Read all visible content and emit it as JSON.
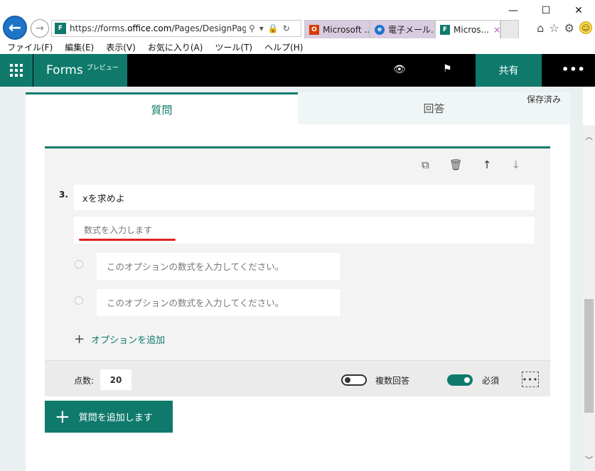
{
  "browser": {
    "url_prefix": "https://forms.",
    "url_domain": "office.com",
    "url_path": "/Pages/DesignPage.aspx",
    "tabs": [
      {
        "label": "Microsoft ..."
      },
      {
        "label": "電子メール..."
      },
      {
        "label": "Micros..."
      }
    ],
    "tab_close": "×"
  },
  "menu": {
    "items": [
      "ファイル(F)",
      "編集(E)",
      "表示(V)",
      "お気に入り(A)",
      "ツール(T)",
      "ヘルプ(H)"
    ]
  },
  "appbar": {
    "brand": "Forms",
    "preview_tag": "プレビュー",
    "share_label": "共有",
    "more_label": "•••"
  },
  "tabs": {
    "questions": "質問",
    "responses": "回答"
  },
  "status": {
    "saved": "保存済み"
  },
  "question": {
    "number": "3.",
    "title": "xを求めよ",
    "formula_placeholder": "数式を入力します",
    "options": [
      {
        "placeholder": "このオプションの数式を入力してください。"
      },
      {
        "placeholder": "このオプションの数式を入力してください。"
      }
    ],
    "add_option_label": "オプションを追加",
    "points_label": "点数:",
    "points_value": "20",
    "multiple_answers_label": "複数回答",
    "multiple_answers_on": false,
    "required_label": "必須",
    "required_on": true,
    "more_label": "•••"
  },
  "add_question_label": "質問を追加します",
  "colors": {
    "accent": "#0f7a6c",
    "underline": "#e02020"
  }
}
